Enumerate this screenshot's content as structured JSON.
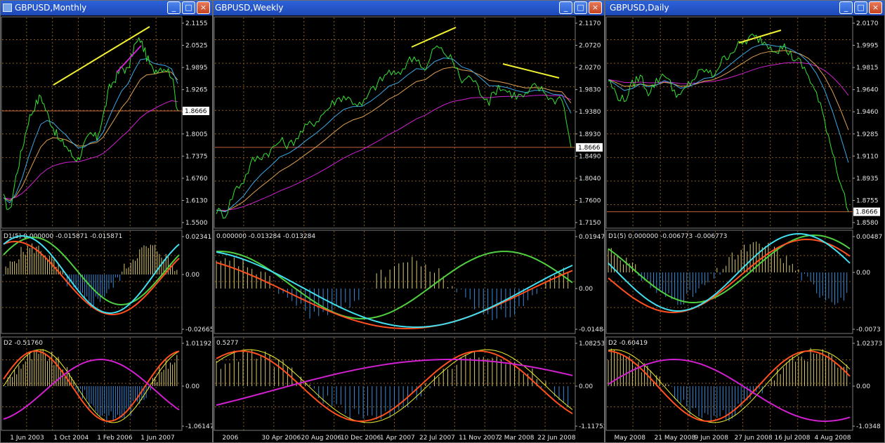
{
  "colors": {
    "background": "#000000",
    "grid": "#8a5a1e",
    "price_green": "#35e035",
    "ma_cyan": "#3aa8e8",
    "ma_orange": "#e0a050",
    "ma_magenta": "#d020d0",
    "trend_yellow": "#f0f030",
    "osc_cyan": "#40e0f0",
    "osc_red": "#ff5020",
    "osc_green": "#50d040",
    "hist_yellow": "#d8c870",
    "hist_blue": "#3a8ad8",
    "hline_red": "#c06040"
  },
  "windows": [
    {
      "title": "GBPUSD,Monthly",
      "icon": "chart-window-icon",
      "price_axis": [
        "2.1155",
        "2.0525",
        "1.9895",
        "1.9265",
        "1.8635",
        "1.8005",
        "1.7375",
        "1.6760",
        "1.6130",
        "1.5500"
      ],
      "current_price": "1.8666",
      "sub1_label": "D1(5) 0.000000 -0.015871 -0.015871",
      "sub1_axis": [
        "0.02341",
        "0.00",
        "-0.02665"
      ],
      "sub2_label": "D2 -0.51760",
      "sub2_axis": [
        "1.01192",
        "0.00",
        "-1.06147"
      ],
      "dates": [
        "1 Jun 2003",
        "1 Oct 2004",
        "1 Feb 2006",
        "1 Jun 2007"
      ]
    },
    {
      "title": "GBPUSD,Weekly",
      "icon": "chart-window-icon",
      "price_axis": [
        "2.1170",
        "2.0720",
        "2.0270",
        "1.9830",
        "1.9380",
        "1.8930",
        "1.8490",
        "1.8040",
        "1.7600",
        "1.7150"
      ],
      "current_price": "1.8666",
      "sub1_label": "0.000000 -0.013284 -0.013284",
      "sub1_axis": [
        "0.01947",
        "0.00",
        "-0.01484"
      ],
      "sub2_label": "0.5277",
      "sub2_axis": [
        "1.08253",
        "0.00",
        "-1.11752"
      ],
      "dates": [
        "2006",
        "30 Apr 2006",
        "20 Aug 2006",
        "10 Dec 2006",
        "1 Apr 2007",
        "22 Jul 2007",
        "11 Nov 2007",
        "2 Mar 2008",
        "22 Jun 2008"
      ]
    },
    {
      "title": "GBPUSD,Daily",
      "icon": "chart-window-icon",
      "price_axis": [
        "2.0170",
        "1.9995",
        "1.9815",
        "1.9640",
        "1.9460",
        "1.9285",
        "1.9110",
        "1.8935",
        "1.8755",
        "1.8580"
      ],
      "current_price": "1.8666",
      "sub1_label": "D1(5) 0.000000 -0.006773 -0.006773",
      "sub1_axis": [
        "0.00487",
        "0.00",
        "-0.0073"
      ],
      "sub2_label": "D2 -0.60419",
      "sub2_axis": [
        "1.02373",
        "0.00",
        "-1.0348"
      ],
      "dates": [
        "May 2008",
        "21 May 2008",
        "9 Jun 2008",
        "27 Jun 2008",
        "16 Jul 2008",
        "4 Aug 2008"
      ]
    }
  ],
  "title_buttons": {
    "minimize": "_",
    "maximize": "□",
    "close": "×"
  },
  "chart_data": [
    {
      "type": "line",
      "title": "GBPUSD,Monthly",
      "ylim": [
        1.55,
        2.1155
      ],
      "x": [
        "1 Jun 2003",
        "1 Oct 2004",
        "1 Feb 2006",
        "1 Jun 2007"
      ],
      "series": [
        {
          "values": [
            1.62,
            1.58,
            1.68,
            1.76,
            1.84,
            1.88,
            1.91,
            1.86,
            1.82,
            1.78,
            1.77,
            1.74,
            1.73,
            1.77,
            1.8,
            1.79,
            1.85,
            1.93,
            1.96,
            1.99,
            1.98,
            2.05,
            2.07,
            2.02,
            1.98,
            1.99,
            1.99,
            1.97,
            1.8666
          ]
        }
      ]
    },
    {
      "type": "line",
      "title": "GBPUSD,Weekly",
      "ylim": [
        1.715,
        2.117
      ],
      "x": [
        "2006",
        "30 Apr 2006",
        "20 Aug 2006",
        "10 Dec 2006",
        "1 Apr 2007",
        "22 Jul 2007",
        "11 Nov 2007",
        "2 Mar 2008",
        "22 Jun 2008"
      ],
      "series": [
        {
          "values": [
            1.74,
            1.73,
            1.78,
            1.8,
            1.84,
            1.85,
            1.86,
            1.88,
            1.87,
            1.89,
            1.91,
            1.92,
            1.94,
            1.96,
            1.97,
            1.96,
            1.95,
            1.98,
            2.0,
            2.02,
            2.01,
            2.04,
            2.05,
            2.02,
            2.07,
            2.06,
            2.04,
            2.0,
            2.01,
            1.98,
            1.96,
            1.99,
            1.98,
            1.97,
            1.97,
            1.99,
            1.98,
            1.96,
            1.97,
            1.8666
          ]
        }
      ]
    },
    {
      "type": "line",
      "title": "GBPUSD,Daily",
      "ylim": [
        1.858,
        2.017
      ],
      "x": [
        "May 2008",
        "21 May 2008",
        "9 Jun 2008",
        "27 Jun 2008",
        "16 Jul 2008",
        "4 Aug 2008"
      ],
      "series": [
        {
          "values": [
            1.972,
            1.96,
            1.955,
            1.968,
            1.975,
            1.962,
            1.97,
            1.978,
            1.965,
            1.958,
            1.968,
            1.975,
            1.98,
            1.975,
            1.985,
            1.992,
            1.998,
            2.002,
            2.006,
            2.004,
            2.0,
            1.996,
            1.998,
            1.99,
            1.985,
            1.975,
            1.96,
            1.94,
            1.915,
            1.89,
            1.8666
          ]
        }
      ]
    }
  ]
}
